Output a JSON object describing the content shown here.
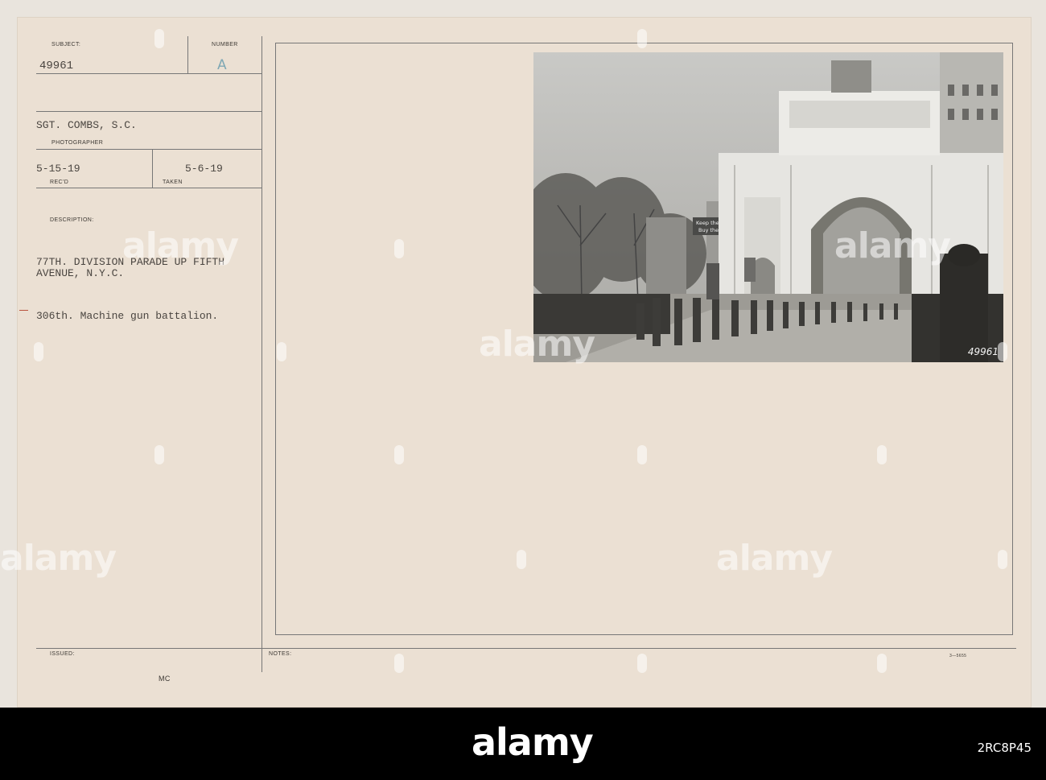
{
  "card": {
    "subject_label": "SUBJECT:",
    "subject_value": "49961",
    "number_label": "NUMBER",
    "number_value": "A",
    "photographer_value": "SGT. COMBS, S.C.",
    "photographer_label": "PHOTOGRAPHER",
    "recd_value": "5-15-19",
    "recd_label": "REC'D",
    "taken_value": "5-6-19",
    "taken_label": "TAKEN",
    "description_label": "DESCRIPTION:",
    "description_line1": "77TH. DIVISION PARADE UP FIFTH",
    "description_line2": "AVENUE, N.Y.C.",
    "description_line3": "306th. Machine gun battalion.",
    "issued_label": "ISSUED:",
    "issued_value": "MC",
    "notes_label": "NOTES:",
    "form_code": "3—5655"
  },
  "photo": {
    "banner_line1": "Keep the F",
    "banner_line2": "Buy the F",
    "negative_number": "49961"
  },
  "watermark": {
    "text": "alamy"
  },
  "footer": {
    "logo": "alamy",
    "image_id": "2RC8P45"
  }
}
